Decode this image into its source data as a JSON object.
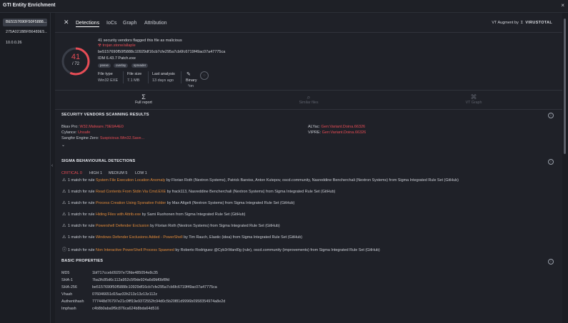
{
  "window": {
    "title": "GTI Entity Enrichment",
    "close": "×"
  },
  "sidebar": {
    "items": [
      {
        "label": "BE5157690F50F5888...",
        "active": true
      },
      {
        "label": "275A021BBFB6489E5...",
        "active": false
      },
      {
        "label": "10.0.0.26",
        "active": false
      }
    ],
    "collapse": "‹"
  },
  "tabs": {
    "close": "✕",
    "items": [
      "Detections",
      "IoCs",
      "Graph",
      "Attribution"
    ],
    "active": "Detections"
  },
  "vt_augment": {
    "label": "VT Augment by",
    "logo": "VIRUSTOTAL"
  },
  "summary": {
    "detections": "41",
    "total": "/ 72",
    "headline": "41 security vendors flagged this file as malicious",
    "threat": "trojan.stone/allaple",
    "hash": "be5157690f50f5888c10929df16cb7cfe295a7cb6fc6719f49ac07a47775ca",
    "filename": "IDM 6.43.7 Patch.exe",
    "tags": [
      "peexe",
      "overlay",
      "spreader"
    ],
    "file_type_label": "File type",
    "file_type": "Win32 EXE",
    "file_size_label": "File size",
    "file_size": "7.1 MB",
    "last_analysis_label": "Last analysis",
    "last_analysis": "13 days ago",
    "binary_label": "Binary",
    "binary_sub": "²on",
    "accent": "#e74c55"
  },
  "actions": [
    {
      "label": "Full report",
      "icon": "Σ",
      "enabled": true
    },
    {
      "label": "Similar files",
      "icon": "⌕",
      "enabled": false
    },
    {
      "label": "VT Graph",
      "icon": "⌘",
      "enabled": false
    }
  ],
  "vendors": {
    "heading": "SECURITY VENDORS SCANNING RESULTS",
    "left": [
      {
        "name": "Bkav Pro:",
        "result": "W32.Malware.79E9A4E0",
        "color": "red"
      },
      {
        "name": "Cylance:",
        "result": "Unsafe",
        "color": "red"
      },
      {
        "name": "Sangfor Engine Zero:",
        "result": "Suspicious.Win32.Save...",
        "color": "red"
      }
    ],
    "right": [
      {
        "name": "ALYac:",
        "result": "Gen:Variant.Doina.66326",
        "color": "red"
      },
      {
        "name": "VIPRE:",
        "result": "Gen:Variant.Doina.66326",
        "color": "red"
      }
    ],
    "expand": "⌄"
  },
  "sigma": {
    "heading": "SIGMA BEHAVIOURAL DETECTIONS",
    "severity": [
      {
        "label": "CRITICAL 0",
        "color": "#e74c55"
      },
      {
        "label": "HIGH 1",
        "color": "#c9ccd3"
      },
      {
        "label": "MEDIUM 5",
        "color": "#c9ccd3"
      },
      {
        "label": "LOW 1",
        "color": "#c9ccd3"
      }
    ],
    "rules": [
      {
        "icon": "warning",
        "prefix": "1 match for rule",
        "rule": "System File Execution Location Anomaly",
        "by": "by Florian Roth (Nextron Systems), Patrick Bareiss, Anton Kutepov, oscd.community, Nasreddine Bencherchali (Nextron Systems) from Sigma Integrated Rule Set (GitHub)"
      },
      {
        "icon": "warning",
        "prefix": "1 match for rule",
        "rule": "Read Contents From Stdin Via Cmd.EXE",
        "by": "by frack113, Nasreddine Bencherchali (Nextron Systems) from Sigma Integrated Rule Set (GitHub)"
      },
      {
        "icon": "warning",
        "prefix": "1 match for rule",
        "rule": "Process Creation Using Sysnative Folder",
        "by": "by Max Altgelt (Nextron Systems) from Sigma Integrated Rule Set (GitHub)"
      },
      {
        "icon": "warning",
        "prefix": "1 match for rule",
        "rule": "Hiding Files with Attrib.exe",
        "by": "by Sami Ruohonen from Sigma Integrated Rule Set (GitHub)"
      },
      {
        "icon": "warning",
        "prefix": "1 match for rule",
        "rule": "Powershell Defender Exclusion",
        "by": "by Florian Roth (Nextron Systems) from Sigma Integrated Rule Set (GitHub)"
      },
      {
        "icon": "warning",
        "prefix": "1 match for rule",
        "rule": "Windows Defender Exclusions Added - PowerShell",
        "by": "by Tim Rauch, Elastic (idea) from Sigma Integrated Rule Set (GitHub)"
      },
      {
        "icon": "info",
        "prefix": "1 match for rule",
        "rule": "Non Interactive PowerShell Process Spawned",
        "by": "by Roberto Rodriguez @Cyb3rWard0g (rule), oscd.community (improvements) from Sigma Integrated Rule Set (GitHub)"
      }
    ]
  },
  "properties": {
    "heading": "BASIC PROPERTIES",
    "rows": [
      {
        "label": "MD5",
        "value": "1bf717cceb09297e72fde485054e8c35"
      },
      {
        "label": "SHA-1",
        "value": "7ba3fc85d6c112a952c5f9de924a6d9bf0bf8fd"
      },
      {
        "label": "SHA-256",
        "value": "be5157690f50f5888c10929df16cb7cfe295a7cb6fc6719f49ac07a47775ca"
      },
      {
        "label": "Vhash",
        "value": "076046651d15az33h213z13z13z112z"
      },
      {
        "label": "Authentihash",
        "value": "777448d76797e21c0fff19e9372552fc94d0c5b20f81d9996b0958354974a8e2d"
      },
      {
        "label": "Imphash",
        "value": "c4b8b0aba9f9c876ca624b8bda64d516"
      }
    ]
  }
}
